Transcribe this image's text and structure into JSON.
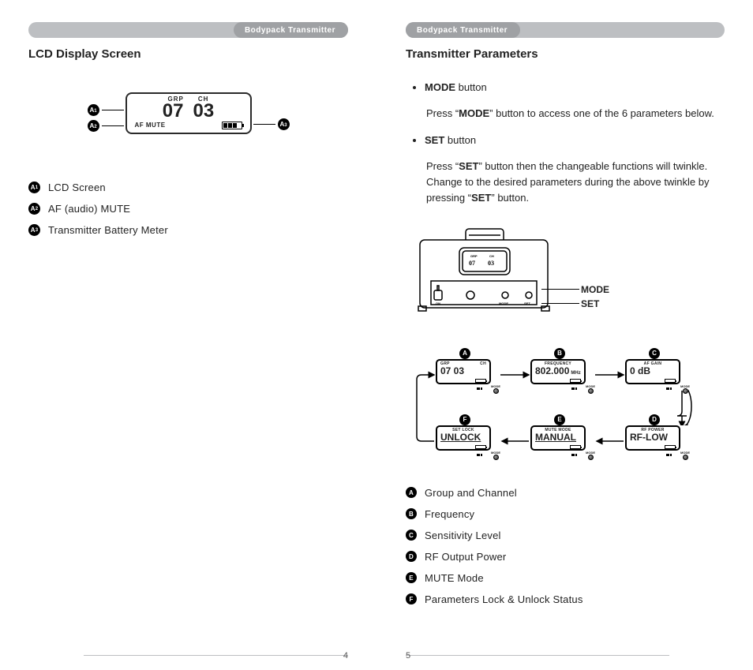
{
  "left": {
    "header": "Bodypack Transmitter",
    "title": "LCD Display Screen",
    "lcd": {
      "grp_label": "GRP",
      "ch_label": "CH",
      "grp_value": "07",
      "ch_value": "03",
      "af_mute": "AF MUTE"
    },
    "badges": {
      "a1": "A1",
      "a2": "A2",
      "a3": "A3"
    },
    "legend": [
      {
        "badge": "A1",
        "text": "LCD Screen"
      },
      {
        "badge": "A2",
        "text": "AF (audio) MUTE"
      },
      {
        "badge": "A3",
        "text": "Transmitter Battery Meter"
      }
    ],
    "page_number": "4"
  },
  "right": {
    "header": "Bodypack Transmitter",
    "title": "Transmitter Parameters",
    "mode_bullet": "MODE",
    "mode_bullet_suffix": " button",
    "mode_para_1a": "Press “",
    "mode_para_1b": "MODE",
    "mode_para_1c": "” button to access one of the 6 parameters below.",
    "set_bullet": "SET",
    "set_bullet_suffix": " button",
    "set_para_1a": "Press “",
    "set_para_1b": "SET",
    "set_para_1c": "” button then the changeable functions will twinkle. Change to the desired parameters during the above twinkle by pressing “",
    "set_para_1d": "SET",
    "set_para_1e": "” button.",
    "tx_labels": {
      "mode": "MODE",
      "set": "SET"
    },
    "tx_small": {
      "grp": "GRP",
      "ch": "CH",
      "grp_v": "07",
      "ch_v": "03",
      "on": "ON",
      "mode": "MODE",
      "set": "SET"
    },
    "mode_knob_label": "MODE",
    "flow": {
      "A": {
        "title_left": "GRP",
        "title_right": "CH",
        "value": "07  03",
        "unit": ""
      },
      "B": {
        "title": "FREQUENCY",
        "value": "802.000",
        "unit": "MHz"
      },
      "C": {
        "title": "AF  GAIN",
        "value": "0 dB",
        "unit": ""
      },
      "D": {
        "title": "RF  POWER",
        "value": "RF-LOW",
        "unit": ""
      },
      "E": {
        "title": "MUTE  MODE",
        "value": "MANUAL",
        "unit": ""
      },
      "F": {
        "title": "SET  LOCK",
        "value": "UNLOCK",
        "unit": ""
      }
    },
    "flow_badges": {
      "A": "A",
      "B": "B",
      "C": "C",
      "D": "D",
      "E": "E",
      "F": "F"
    },
    "legend": [
      {
        "badge": "A",
        "text": "Group and Channel"
      },
      {
        "badge": "B",
        "text": "Frequency"
      },
      {
        "badge": "C",
        "text": "Sensitivity Level"
      },
      {
        "badge": "D",
        "text": "RF Output Power"
      },
      {
        "badge": "E",
        "text": "MUTE Mode"
      },
      {
        "badge": "F",
        "text": "Parameters Lock & Unlock Status"
      }
    ],
    "page_number": "5"
  }
}
